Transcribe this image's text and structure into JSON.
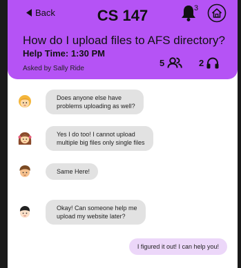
{
  "header": {
    "back_label": "Back",
    "course_title": "CS 147",
    "notification_count": "3",
    "question": "How do I upload files to AFS directory?",
    "help_time": "Help Time: 1:30 PM",
    "asked_by": "Asked by Sally Ride",
    "people_count": "5",
    "listener_count": "2",
    "accent_color": "#b553f5"
  },
  "messages": [
    {
      "avatar": "blonde-girl-avatar",
      "text": "Does anyone else have\nproblems uploading as well?"
    },
    {
      "avatar": "brunette-girl-avatar",
      "text": "Yes I do too! I cannot upload\nmultiple big files only single files"
    },
    {
      "avatar": "boy-avatar",
      "text": "Same Here!"
    },
    {
      "avatar": "dark-hair-boy-avatar",
      "text": "Okay! Can someone help me\nupload my website later?"
    }
  ],
  "my_message": {
    "text": "I figured it out! I can help you!",
    "bubble_color": "#ecd7f9"
  }
}
